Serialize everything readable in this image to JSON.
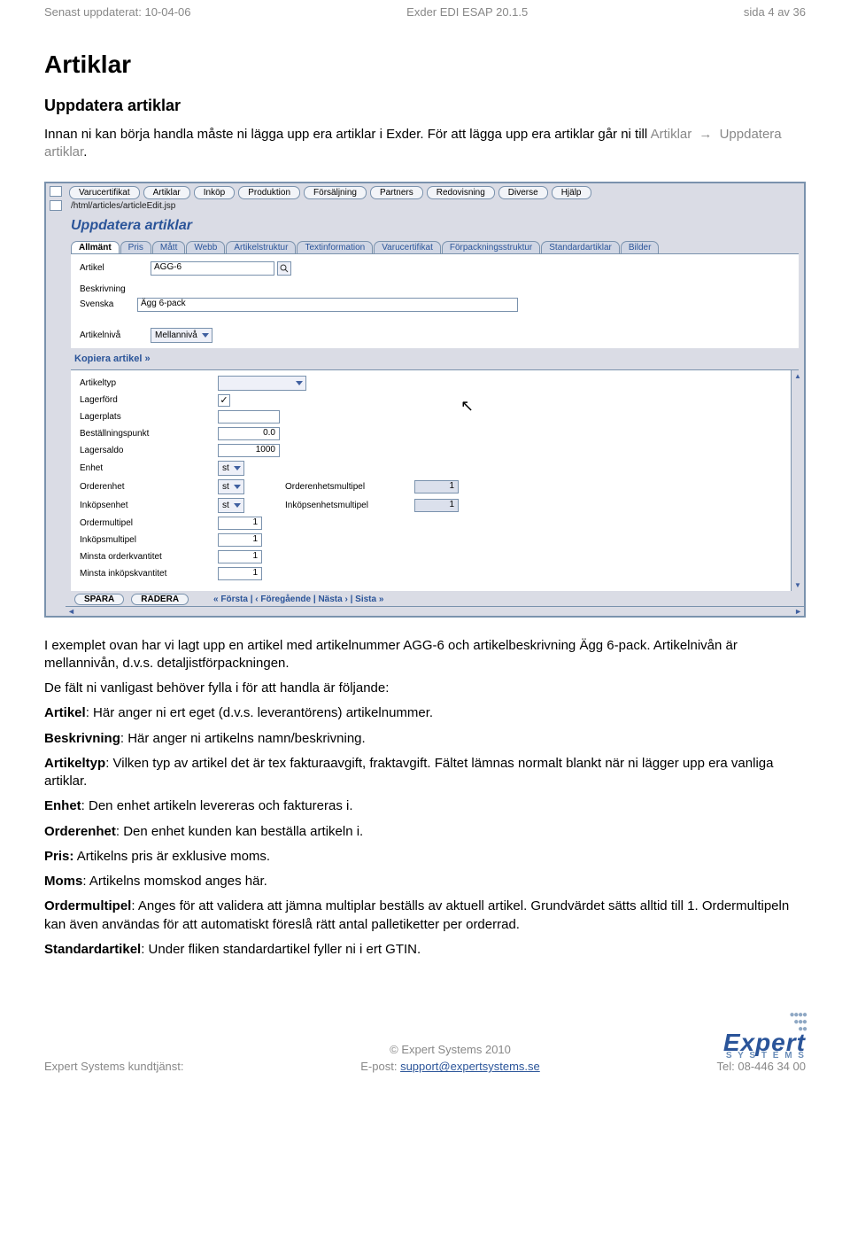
{
  "header": {
    "left": "Senast uppdaterat: 10-04-06",
    "center": "Exder EDI ESAP 20.1.5",
    "right": "sida 4 av 36"
  },
  "h1": "Artiklar",
  "h2": "Uppdatera artiklar",
  "intro_1": "Innan ni kan börja handla måste ni lägga upp era artiklar i Exder. För att lägga upp era artiklar går ni till ",
  "intro_link1": "Artiklar",
  "intro_arrow": "→",
  "intro_link2": "Uppdatera artiklar",
  "intro_period": ".",
  "screenshot": {
    "menubar": [
      "Varucertifikat",
      "Artiklar",
      "Inköp",
      "Produktion",
      "Försäljning",
      "Partners",
      "Redovisning",
      "Diverse",
      "Hjälp"
    ],
    "path": "/html/articles/articleEdit.jsp",
    "title": "Uppdatera artiklar",
    "tabs": [
      "Allmänt",
      "Pris",
      "Mått",
      "Webb",
      "Artikelstruktur",
      "Textinformation",
      "Varucertifikat",
      "Förpackningsstruktur",
      "Standardartiklar",
      "Bilder"
    ],
    "panel": {
      "artikel_lbl": "Artikel",
      "artikel_val": "AGG-6",
      "beskrivning_lbl": "Beskrivning",
      "svenska_lbl": "Svenska",
      "svenska_val": "Ägg 6-pack",
      "artikelniva_lbl": "Artikelnivå",
      "artikelniva_val": "Mellannivå"
    },
    "kopiera": "Kopiera artikel »",
    "grid": {
      "rows": [
        {
          "label": "Artikeltyp",
          "type": "select",
          "value": ""
        },
        {
          "label": "Lagerförd",
          "type": "check",
          "value": "✓"
        },
        {
          "label": "Lagerplats",
          "type": "input",
          "value": ""
        },
        {
          "label": "Beställningspunkt",
          "type": "num",
          "value": "0.0"
        },
        {
          "label": "Lagersaldo",
          "type": "num",
          "value": "1000"
        },
        {
          "label": "Enhet",
          "type": "unitselect",
          "value": "st"
        },
        {
          "label": "Orderenhet",
          "type": "unitselect",
          "value": "st",
          "midlabel": "Orderenhetsmultipel",
          "midvalue": "1"
        },
        {
          "label": "Inköpsenhet",
          "type": "unitselect",
          "value": "st",
          "midlabel": "Inköpsenhetsmultipel",
          "midvalue": "1"
        },
        {
          "label": "Ordermultipel",
          "type": "num50",
          "value": "1"
        },
        {
          "label": "Inköpsmultipel",
          "type": "num50",
          "value": "1"
        },
        {
          "label": "Minsta orderkvantitet",
          "type": "num50",
          "value": "1"
        },
        {
          "label": "Minsta inköpskvantitet",
          "type": "num50",
          "value": "1"
        }
      ]
    },
    "footer": {
      "buttons": [
        "SPARA",
        "RADERA"
      ],
      "nav": "« Första | ‹ Föregående | Nästa › | Sista »"
    }
  },
  "body": {
    "p1": "I exemplet ovan har vi lagt upp en artikel med artikelnummer AGG-6 och artikelbeskrivning Ägg 6-pack. Artikelnivån är mellannivån, d.v.s. detaljistförpackningen.",
    "p2": "De fält ni vanligast behöver fylla i för att handla är följande:",
    "p3_b": "Artikel",
    "p3": ": Här anger ni ert eget (d.v.s. leverantörens) artikelnummer.",
    "p4_b": "Beskrivning",
    "p4": ": Här anger ni artikelns namn/beskrivning.",
    "p5_b": "Artikeltyp",
    "p5": ": Vilken typ av artikel det är tex fakturaavgift, fraktavgift. Fältet lämnas normalt blankt när ni lägger upp era vanliga artiklar.",
    "p6_b": "Enhet",
    "p6": ": Den enhet artikeln levereras och faktureras i.",
    "p7_b": "Orderenhet",
    "p7": ": Den enhet kunden kan beställa artikeln i.",
    "p8_b": "Pris:",
    "p8": " Artikelns pris är exklusive moms.",
    "p9_b": "Moms",
    "p9": ": Artikelns momskod anges här.",
    "p10_b": "Ordermultipel",
    "p10": ": Anges för att validera att jämna multiplar beställs av aktuell artikel. Grundvärdet sätts alltid till 1. Ordermultipeln kan även användas för att automatiskt föreslå rätt antal palletiketter per orderrad.",
    "p11_b": "Standardartikel",
    "p11": ": Under fliken standardartikel fyller ni i ert GTIN."
  },
  "footer": {
    "left": "Expert Systems kundtjänst:",
    "center_cop": "© Expert Systems 2010",
    "center_epost_lbl": "E-post: ",
    "center_epost_link": "support@expertsystems.se",
    "tel": "Tel: 08-446 34 00",
    "logo_main": "Expert",
    "logo_sub": "S Y S T E M S"
  }
}
